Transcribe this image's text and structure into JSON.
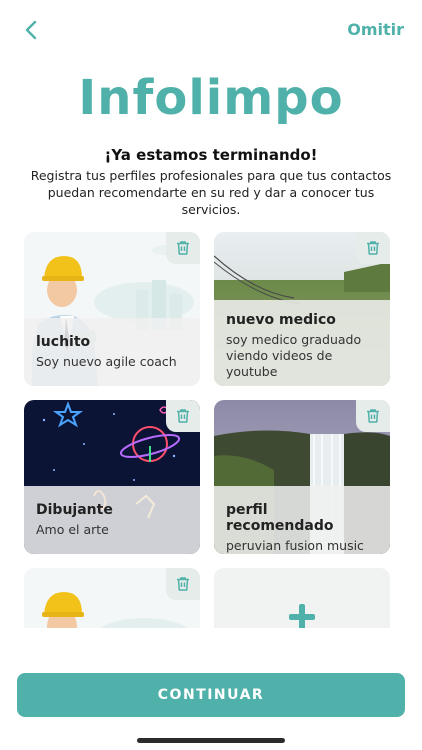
{
  "header": {
    "back_icon": "chevron-left-icon",
    "skip_label": "Omitir"
  },
  "brand": {
    "name": "Infolimpo"
  },
  "intro": {
    "headline": "¡Ya estamos terminando!",
    "description": "Registra tus perfiles profesionales para que tus contactos puedan recomendarte en su red y dar a conocer tus servicios."
  },
  "profiles": [
    {
      "name": "luchito",
      "description": "Soy nuevo agile coach",
      "image": "worker-illustration"
    },
    {
      "name": "nuevo medico",
      "description": "soy medico graduado viendo videos de youtube",
      "image": "grass-photo"
    },
    {
      "name": "Dibujante",
      "description": "Amo el arte",
      "image": "neon-art"
    },
    {
      "name": "perfil recomendado",
      "description": "peruvian fusion music",
      "image": "waterfall-photo"
    },
    {
      "name": "",
      "description": "",
      "image": "worker-illustration"
    }
  ],
  "add_card": {
    "icon": "plus-icon"
  },
  "icons": {
    "delete": "trash-icon"
  },
  "footer": {
    "continue_label": "CONTINUAR"
  },
  "colors": {
    "accent": "#4fb1a9",
    "card_overlay": "#f0f0f0",
    "text": "#222222"
  }
}
